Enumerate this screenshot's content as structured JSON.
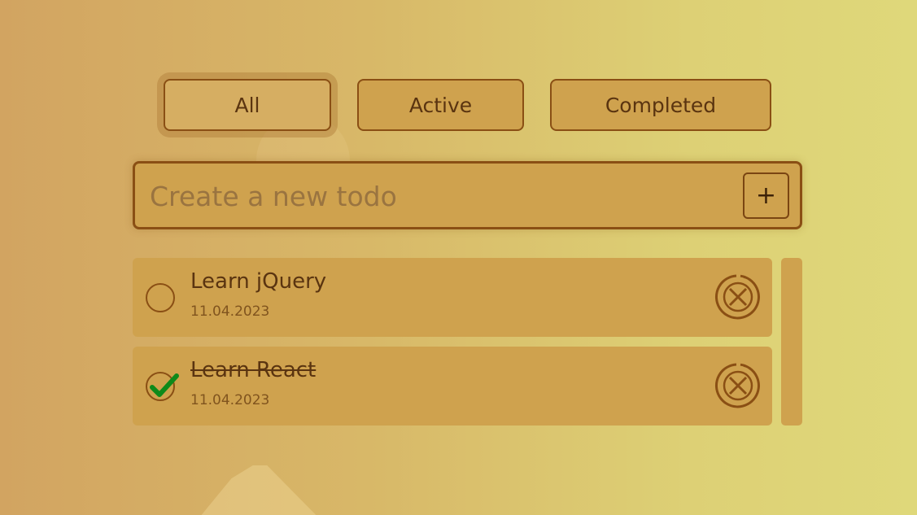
{
  "filters": {
    "all_label": "All",
    "active_label": "Active",
    "completed_label": "Completed",
    "selected": "All"
  },
  "new_todo": {
    "placeholder": "Create a new todo",
    "value": "",
    "add_label": "+"
  },
  "todos": [
    {
      "title": "Learn jQuery",
      "date": "11.04.2023",
      "completed": false
    },
    {
      "title": "Learn React",
      "date": "11.04.2023",
      "completed": true
    }
  ],
  "colors": {
    "accent": "#8a4f14",
    "card": "#cfa24e",
    "check": "#0e8a1a"
  },
  "icons": {
    "add": "plus-icon",
    "delete": "close-circle-icon",
    "done": "checkmark-icon"
  }
}
